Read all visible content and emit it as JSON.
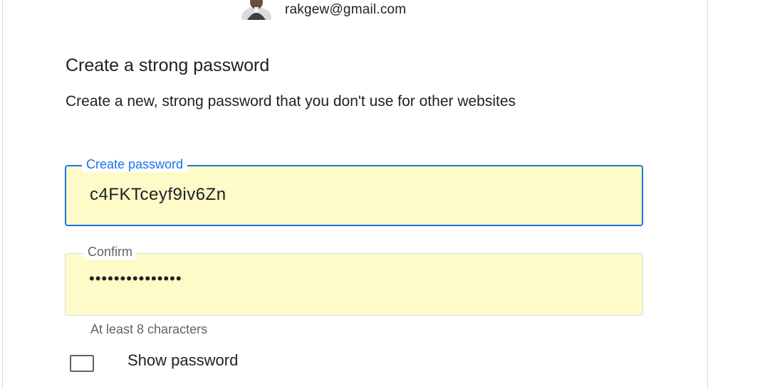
{
  "account": {
    "email": "rakgew@gmail.com",
    "avatar_icon": "user-avatar-icon"
  },
  "heading": {
    "title": "Create a strong password",
    "subtitle": "Create a new, strong password that you don't use for other websites"
  },
  "fields": {
    "create_password": {
      "label": "Create password",
      "value": "c4FKTceyf9iv6Zn",
      "state": "focused"
    },
    "confirm": {
      "label": "Confirm",
      "value": "•••••••••••••••",
      "state": "filled"
    }
  },
  "helper_text": "At least 8 characters",
  "show_password": {
    "label": "Show password",
    "checked": false
  },
  "colors": {
    "focus_blue": "#1a73e8",
    "autofill_yellow": "#fefbc8",
    "text": "#202124",
    "muted": "#5f6368",
    "border": "#dadce0"
  }
}
